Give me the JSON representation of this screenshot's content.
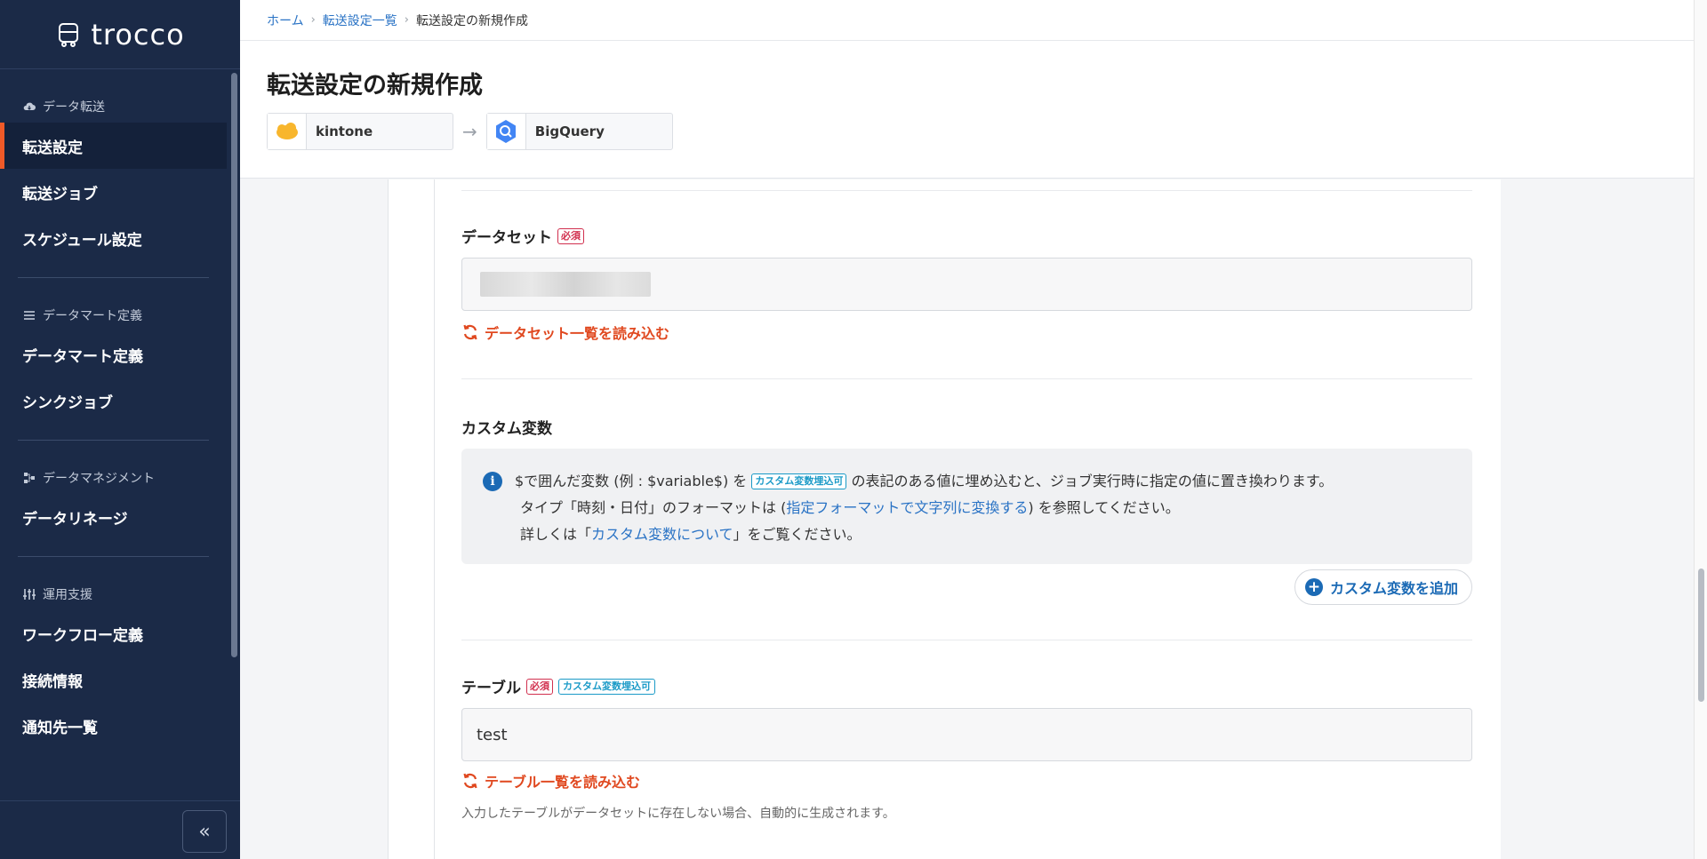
{
  "app": {
    "logo_text": "trocco"
  },
  "sidebar": {
    "sections": [
      {
        "title": "データ転送",
        "icon": "cloud-icon",
        "items": [
          "転送設定",
          "転送ジョブ",
          "スケジュール設定"
        ]
      },
      {
        "title": "データマート定義",
        "icon": "list-icon",
        "items": [
          "データマート定義",
          "シンクジョブ"
        ]
      },
      {
        "title": "データマネジメント",
        "icon": "lineage-icon",
        "items": [
          "データリネージ"
        ]
      },
      {
        "title": "運用支援",
        "icon": "sliders-icon",
        "items": [
          "ワークフロー定義",
          "接続情報",
          "通知先一覧"
        ]
      }
    ],
    "active_item": "転送設定",
    "collapse_label": "«"
  },
  "breadcrumb": {
    "items": [
      "ホーム",
      "転送設定一覧"
    ],
    "current": "転送設定の新規作成"
  },
  "page": {
    "title": "転送設定の新規作成"
  },
  "connectors": {
    "source": "kintone",
    "destination": "BigQuery"
  },
  "form": {
    "dataset": {
      "label": "データセット",
      "required_badge": "必須",
      "reload_label": "データセット一覧を読み込む"
    },
    "custom_vars": {
      "label": "カスタム変数",
      "info_line1_a": "$で囲んだ変数 (例 : $variable$) を",
      "info_badge": "カスタム変数埋込可",
      "info_line1_b": "の表記のある値に埋め込むと、ジョブ実行時に指定の値に置き換わります。",
      "info_line2_a": "タイプ「時刻・日付」のフォーマットは (",
      "info_line2_link": "指定フォーマットで文字列に変換する",
      "info_line2_b": ") を参照してください。",
      "info_line3_a": "詳しくは「",
      "info_line3_link": "カスタム変数について",
      "info_line3_b": "」をご覧ください。",
      "add_button": "カスタム変数を追加"
    },
    "table": {
      "label": "テーブル",
      "required_badge": "必須",
      "var_badge": "カスタム変数埋込可",
      "value": "test",
      "reload_label": "テーブル一覧を読み込む",
      "help": "入力したテーブルがデータセットに存在しない場合、自動的に生成されます。"
    }
  },
  "colors": {
    "accent": "#f05a28",
    "sidebar_bg": "#1b2a47",
    "link": "#2a73c5",
    "required": "#d12f4e",
    "var_badge": "#1a9ac7"
  }
}
